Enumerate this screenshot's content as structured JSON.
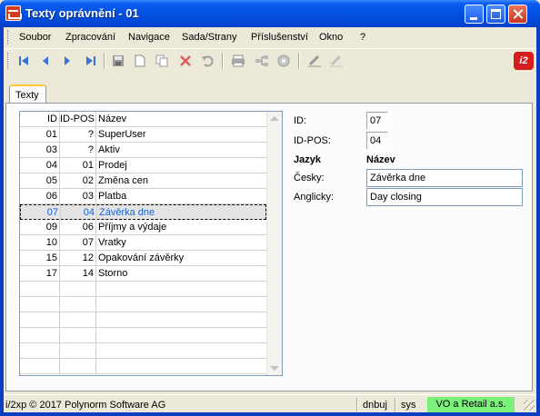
{
  "window": {
    "title": "Texty oprávnění - 01"
  },
  "menu": [
    "Soubor",
    "Zpracování",
    "Navigace",
    "Sada/Strany",
    "Příslušenství",
    "Okno",
    "?"
  ],
  "toolbar": {
    "icons": [
      "first-record-icon",
      "previous-record-icon",
      "next-record-icon",
      "last-record-icon",
      "save-icon",
      "new-icon",
      "copy-icon",
      "delete-icon",
      "undo-icon",
      "print-icon",
      "tree-icon",
      "disc-icon",
      "edit-icon",
      "eraser-icon"
    ],
    "logo": "i2"
  },
  "tab": {
    "label": "Texty"
  },
  "grid": {
    "columns": {
      "id": "ID",
      "id_pos": "ID-POS",
      "name": "Název"
    },
    "rows": [
      {
        "id": "01",
        "id_pos": "?",
        "name": "SuperUser"
      },
      {
        "id": "03",
        "id_pos": "?",
        "name": "Aktiv"
      },
      {
        "id": "04",
        "id_pos": "01",
        "name": "Prodej"
      },
      {
        "id": "05",
        "id_pos": "02",
        "name": "Změna cen"
      },
      {
        "id": "06",
        "id_pos": "03",
        "name": "Platba"
      },
      {
        "id": "07",
        "id_pos": "04",
        "name": "Závěrka dne"
      },
      {
        "id": "09",
        "id_pos": "06",
        "name": "Příjmy a výdaje"
      },
      {
        "id": "10",
        "id_pos": "07",
        "name": "Vratky"
      },
      {
        "id": "15",
        "id_pos": "12",
        "name": "Opakování závěrky"
      },
      {
        "id": "17",
        "id_pos": "14",
        "name": "Storno"
      }
    ],
    "selected_id": "07"
  },
  "detail": {
    "id_label": "ID:",
    "id_value": "07",
    "idpos_label": "ID-POS:",
    "idpos_value": "04",
    "col_lang": "Jazyk",
    "col_name": "Název",
    "cz_label": "Česky:",
    "cz_value": "Závěrka dne",
    "en_label": "Anglicky:",
    "en_value": "Day closing"
  },
  "status": {
    "copyright": "i/2xp © 2017 Polynorm Software AG",
    "user": "dnbuj",
    "mode": "sys",
    "company": "VO a Retail a.s."
  },
  "colors": {
    "title_blue": "#0350e0",
    "selected_text": "#1b63d6",
    "company_green": "#7bf07b",
    "logo_red": "#d41e1e"
  }
}
